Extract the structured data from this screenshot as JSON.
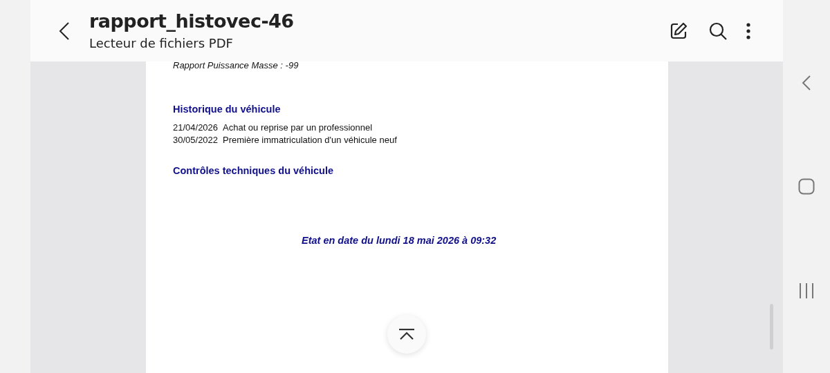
{
  "header": {
    "title": "rapport_histovec-46",
    "subtitle": "Lecteur de fichiers PDF"
  },
  "document": {
    "top_line": "Rapport Puissance Masse : -99",
    "history": {
      "heading": "Historique du véhicule",
      "rows": [
        {
          "date": "21/04/2026",
          "event": "Achat ou reprise par un professionnel"
        },
        {
          "date": "30/05/2022",
          "event": "Première immatriculation d'un véhicule neuf"
        }
      ]
    },
    "inspections": {
      "heading": "Contrôles techniques du véhicule"
    },
    "footer": "Etat en date du lundi 18 mai 2026 à 09:32"
  }
}
